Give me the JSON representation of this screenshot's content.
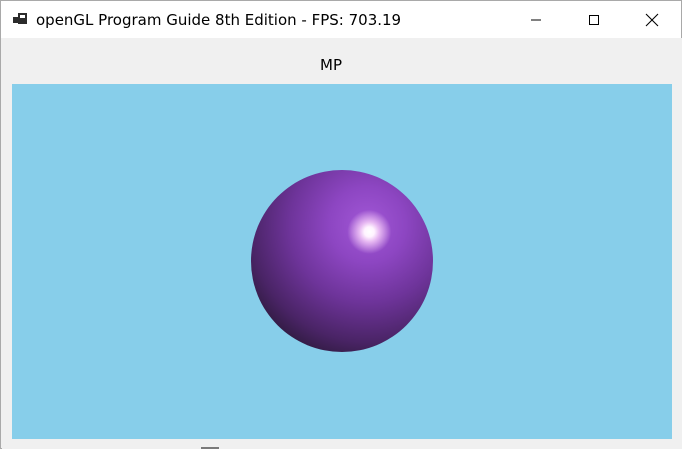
{
  "window": {
    "title": "openGL Program Guide 8th Edition - FPS: 703.19",
    "icons": {
      "app": "app-icon",
      "minimize": "minimize-icon",
      "maximize": "maximize-icon",
      "close": "close-icon"
    }
  },
  "client": {
    "label": "MP",
    "viewport": {
      "background_color": "#87ceea",
      "object": "purple-sphere"
    }
  }
}
